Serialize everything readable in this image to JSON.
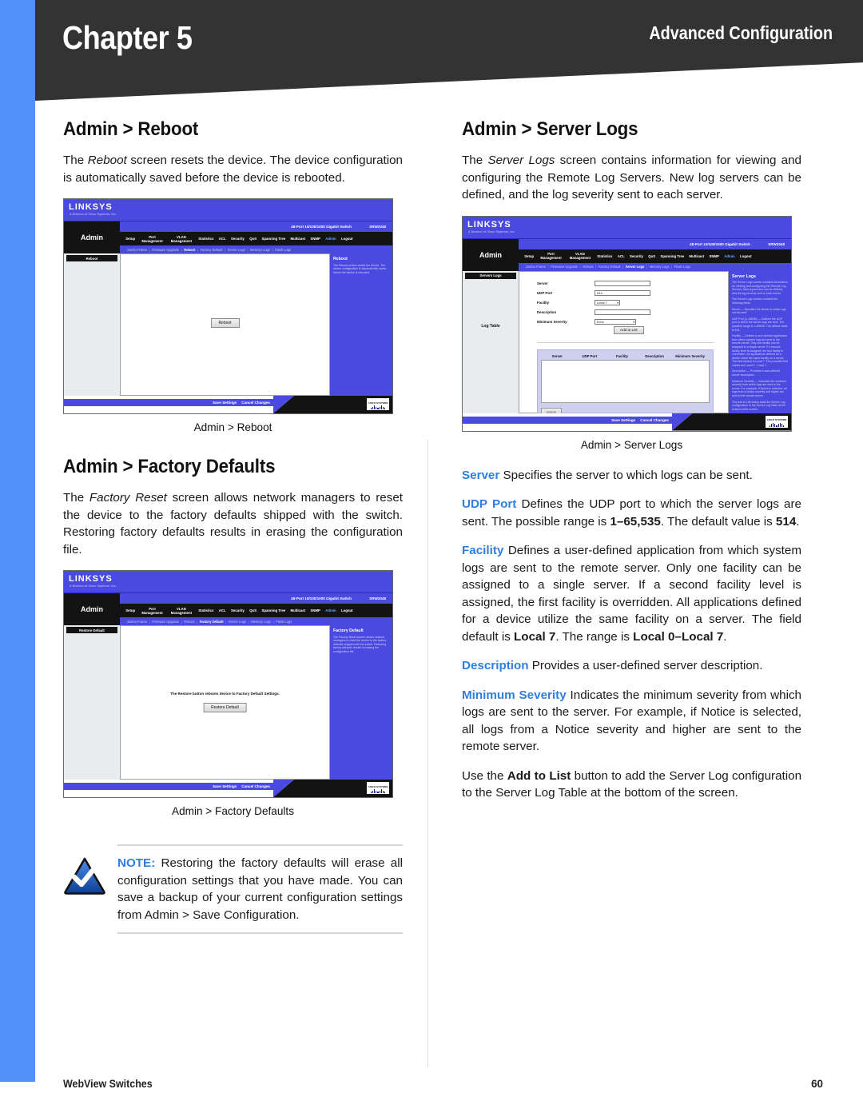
{
  "header": {
    "chapter": "Chapter 5",
    "section": "Advanced Configuration"
  },
  "footer": {
    "product": "WebView Switches",
    "page_number": "60"
  },
  "colors": {
    "accent_blue": "#2f7fe0",
    "stripe_blue": "#5191fa",
    "banner_dark": "#333333",
    "ui_blue": "#4a4ae0"
  },
  "left_column": {
    "reboot": {
      "title": "Admin > Reboot",
      "paragraph_pre": "The ",
      "paragraph_italic": "Reboot",
      "paragraph_post": " screen resets the device. The device configuration is automatically saved before the device is rebooted.",
      "caption": "Admin > Reboot"
    },
    "factory_defaults": {
      "title": "Admin > Factory Defaults",
      "paragraph_pre": "The ",
      "paragraph_italic": "Factory Reset",
      "paragraph_post": " screen allows network managers to reset the device to the factory defaults shipped with the switch. Restoring factory defaults results in erasing the configuration file.",
      "caption": "Admin > Factory Defaults"
    },
    "note": {
      "keyword": "NOTE:",
      "text": " Restoring the factory defaults will erase all configuration settings that you have made. You can save a backup of your current configuration settings from Admin > Save Configuration."
    }
  },
  "right_column": {
    "server_logs": {
      "title": "Admin > Server Logs",
      "paragraph_pre": "The ",
      "paragraph_italic": "Server Logs",
      "paragraph_post": " screen contains information for viewing and configuring the Remote Log Servers. New log servers can be defined, and the log severity sent to each server.",
      "caption": "Admin > Server Logs"
    },
    "definitions": [
      {
        "term": "Server",
        "text": " Specifies the server to which logs can be sent."
      },
      {
        "term": "UDP Port",
        "text_1": " Defines the UDP port to which the server logs are sent. The possible range is ",
        "bold_1": "1–65,535",
        "text_2": ". The default value is ",
        "bold_2": "514",
        "text_3": "."
      },
      {
        "term": "Facility",
        "text_1": " Defines a user-defined application from which system logs are sent to the remote server. Only one facility can be assigned to a single server. If a second facility level is assigned, the first facility is overridden. All applications defined for a device utilize the same facility on a server. The field default is ",
        "bold_1": "Local 7",
        "text_2": ". The range is ",
        "bold_2": "Local 0–Local 7",
        "text_3": "."
      },
      {
        "term": "Description",
        "text": " Provides a user-defined server description."
      },
      {
        "term": "Minimum Severity",
        "text": " Indicates the minimum severity from which logs are sent to the server. For example, if Notice is selected, all logs from a Notice severity and higher are sent to the remote server."
      }
    ],
    "closing": {
      "text_1": "Use the ",
      "bold_1": "Add to List",
      "text_2": " button to add the Server Log configuration to the Server Log Table at the bottom of the screen."
    }
  },
  "ui_screenshots": {
    "common": {
      "brand": "LINKSYS",
      "brand_tagline": "A Division of Cisco Systems, Inc.",
      "module_label": "Admin",
      "model_name": "48-Port 10/100/1000 Gigabit Switch",
      "model_number": "SRW2048",
      "nav_items": [
        "Setup",
        "Port Management",
        "VLAN Management",
        "Statistics",
        "ACL",
        "Security",
        "QoS",
        "Spanning Tree",
        "Multicast",
        "SNMP",
        "Admin",
        "Logout"
      ],
      "active_nav": "Admin",
      "subnav_items": [
        "Jumbo Frame",
        "Firmware Upgrade",
        "Reboot",
        "Factory Default",
        "Server Logs",
        "Memory Logs",
        "Flash Logs"
      ],
      "save_settings": "Save Settings",
      "cancel_changes": "Cancel Changes",
      "cisco_label": "CISCO SYSTEMS"
    },
    "reboot_shot": {
      "sidebar_tab": "Reboot",
      "active_subnav": "Reboot",
      "reboot_button": "Reboot",
      "help_title": "Reboot",
      "help_text": "The Reboot screen resets the device. The device configuration is automatically saved before the device is rebooted."
    },
    "factory_shot": {
      "sidebar_tab": "Restore Default",
      "active_subnav": "Factory Default",
      "notice": "The Restore button reboots device to Factory Default Settings.",
      "restore_button": "Restore Default",
      "help_title": "Factory Default",
      "help_text": "The Factory Reset screen allows network managers to reset the device to the factory defaults shipped with the switch. Restoring factory defaults results in erasing the configuration file."
    },
    "server_logs_shot": {
      "sidebar_tab": "Servers Logs",
      "sidebar_tab_2": "Log Table",
      "active_subnav": "Server Logs",
      "form": [
        {
          "label": "Server",
          "value": "",
          "kind": "input"
        },
        {
          "label": "UDP Port",
          "value": "514",
          "kind": "input"
        },
        {
          "label": "Facility",
          "value": "Local 7",
          "kind": "select"
        },
        {
          "label": "Description",
          "value": "",
          "kind": "input"
        },
        {
          "label": "Minimum Severity",
          "value": "Error",
          "kind": "select-wide"
        }
      ],
      "add_to_list_button": "Add to List",
      "table_headers": [
        "Server",
        "UDP Port",
        "Facility",
        "Description",
        "Minimum Severity"
      ],
      "delete_button": "Delete",
      "help_title": "Server Logs",
      "help_text": "The Server Logs screen contains information for viewing and configuring the Remote Log Servers. New log servers can be defined, and the log severity sent to each server.",
      "help_text_2": "The Server Logs screen contains the following fields:",
      "help_text_3": "Server — Specifies the server to which logs can be sent.",
      "help_text_4": "UDP Port (1–65535) — Defines the UDP port to which the server logs are sent. The possible range is 1–65535. The default value is 514.",
      "help_text_5": "Facility — Defines a user-defined application from which system logs are sent to the remote server. Only one facility can be assigned to a single server. If a second facility level is assigned, the first facility is overridden. All applications defined for a device utilize the same facility on a server. The field default is Local 7. The possible field values are Local 0 - Local 7.",
      "help_text_6": "Description — Provides a user-defined server description.",
      "help_text_7": "Minimum Severity — Indicates the minimum severity from which logs are sent to the server. For example, if Notice is selected, all logs from a Notice severity and higher are sent to the remote server.",
      "help_text_8": "The Add to List button adds the Server Log configuration to the Server Log Table at the bottom of the screen."
    }
  }
}
